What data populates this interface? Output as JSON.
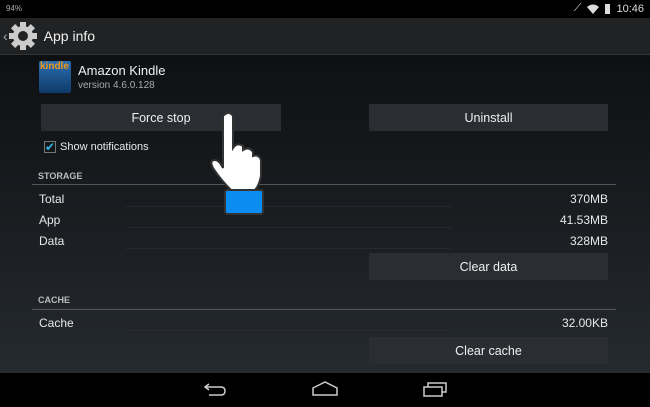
{
  "status_bar": {
    "battery": "94%",
    "time": "10:46",
    "icons": [
      "mute-icon",
      "wifi-icon",
      "battery-icon"
    ]
  },
  "action_bar": {
    "title": "App info",
    "icon": "settings-gear-icon"
  },
  "app": {
    "name": "Amazon Kindle",
    "version": "version 4.6.0.128",
    "icon_text": "kindle"
  },
  "buttons": {
    "force_stop": "Force stop",
    "uninstall": "Uninstall",
    "clear_data": "Clear data",
    "clear_cache": "Clear cache"
  },
  "show_notifications": {
    "label": "Show notifications",
    "checked": true
  },
  "storage": {
    "header": "STORAGE",
    "rows": [
      {
        "label": "Total",
        "value": "370MB"
      },
      {
        "label": "App",
        "value": "41.53MB"
      },
      {
        "label": "Data",
        "value": "328MB"
      }
    ]
  },
  "cache": {
    "header": "CACHE",
    "rows": [
      {
        "label": "Cache",
        "value": "32.00KB"
      }
    ]
  },
  "nav_bar": {
    "icons": [
      "back-icon",
      "home-icon",
      "recent-apps-icon"
    ]
  }
}
